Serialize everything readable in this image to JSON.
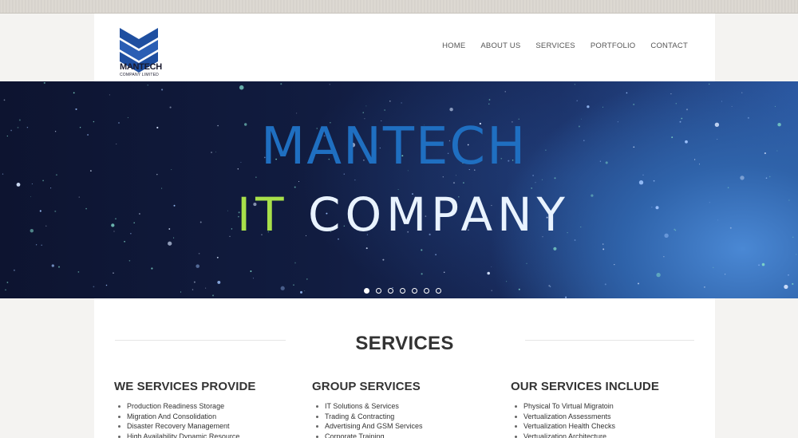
{
  "brand": {
    "name": "MANTECH",
    "tagline": "COMPANY LIMITED",
    "colors": {
      "primary": "#1f4fa0",
      "dark": "#1a1a2e"
    }
  },
  "nav": {
    "items": [
      "HOME",
      "ABOUT US",
      "SERVICES",
      "PORTFOLIO",
      "CONTACT"
    ]
  },
  "hero": {
    "line1": "MANTECH",
    "line2_accent": "IT",
    "line2_rest": " COMPANY",
    "colors": {
      "line1": "#1f6fc1",
      "accent": "#a8e04a",
      "line2": "#e9f3ff"
    },
    "slides_total": 7,
    "active_slide": 1
  },
  "services": {
    "title": "SERVICES",
    "columns": [
      {
        "heading": "WE SERVICES PROVIDE",
        "items": [
          "Production Readiness Storage",
          "Migration And Consolidation",
          "Disaster Recovery Management",
          "High Availability Dynamic Resource"
        ]
      },
      {
        "heading": "GROUP SERVICES",
        "items": [
          "IT Solutions & Services",
          "Trading & Contracting",
          "Advertising And GSM Services",
          "Corporate Training"
        ]
      },
      {
        "heading": "OUR SERVICES INCLUDE",
        "items": [
          "Physical To Virtual Migratoin",
          "Vertualization Assessments",
          "Vertualization Health Checks",
          "Vertualization Architecture"
        ]
      }
    ]
  }
}
